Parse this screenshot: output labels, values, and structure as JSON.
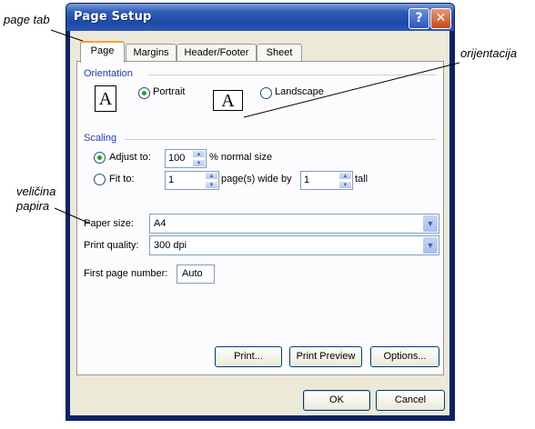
{
  "annotations": {
    "page_tab": "page tab",
    "orientation": "orijentacija",
    "paper_size_line1": "veličina",
    "paper_size_line2": "papira"
  },
  "window": {
    "title": "Page Setup",
    "help_glyph": "?",
    "close_glyph": "✕"
  },
  "tabs": [
    {
      "label": "Page",
      "active": true
    },
    {
      "label": "Margins",
      "active": false
    },
    {
      "label": "Header/Footer",
      "active": false
    },
    {
      "label": "Sheet",
      "active": false
    }
  ],
  "orientation": {
    "group_label": "Orientation",
    "portrait_label": "Portrait",
    "landscape_label": "Landscape",
    "portrait_icon_letter": "A",
    "landscape_icon_letter": "A",
    "selected": "Portrait"
  },
  "scaling": {
    "group_label": "Scaling",
    "adjust_label": "Adjust to:",
    "adjust_value": "100",
    "adjust_suffix": "% normal size",
    "fit_label": "Fit to:",
    "fit_wide_value": "1",
    "fit_wide_suffix": "page(s) wide by",
    "fit_tall_value": "1",
    "fit_tall_suffix": "tall",
    "selected": "Adjust to:"
  },
  "paper_size": {
    "label": "Paper size:",
    "value": "A4"
  },
  "print_quality": {
    "label": "Print quality:",
    "value": "300 dpi"
  },
  "first_page": {
    "label": "First page number:",
    "value": "Auto"
  },
  "buttons": {
    "print": "Print...",
    "print_preview": "Print Preview",
    "options": "Options...",
    "ok": "OK",
    "cancel": "Cancel"
  },
  "colors": {
    "titlebar": "#2e5db8",
    "dialog_bg": "#ECE9D8",
    "group_label": "#1f3fae",
    "active_tab_accent": "#F3A33A",
    "radio_dot": "#21a121"
  }
}
